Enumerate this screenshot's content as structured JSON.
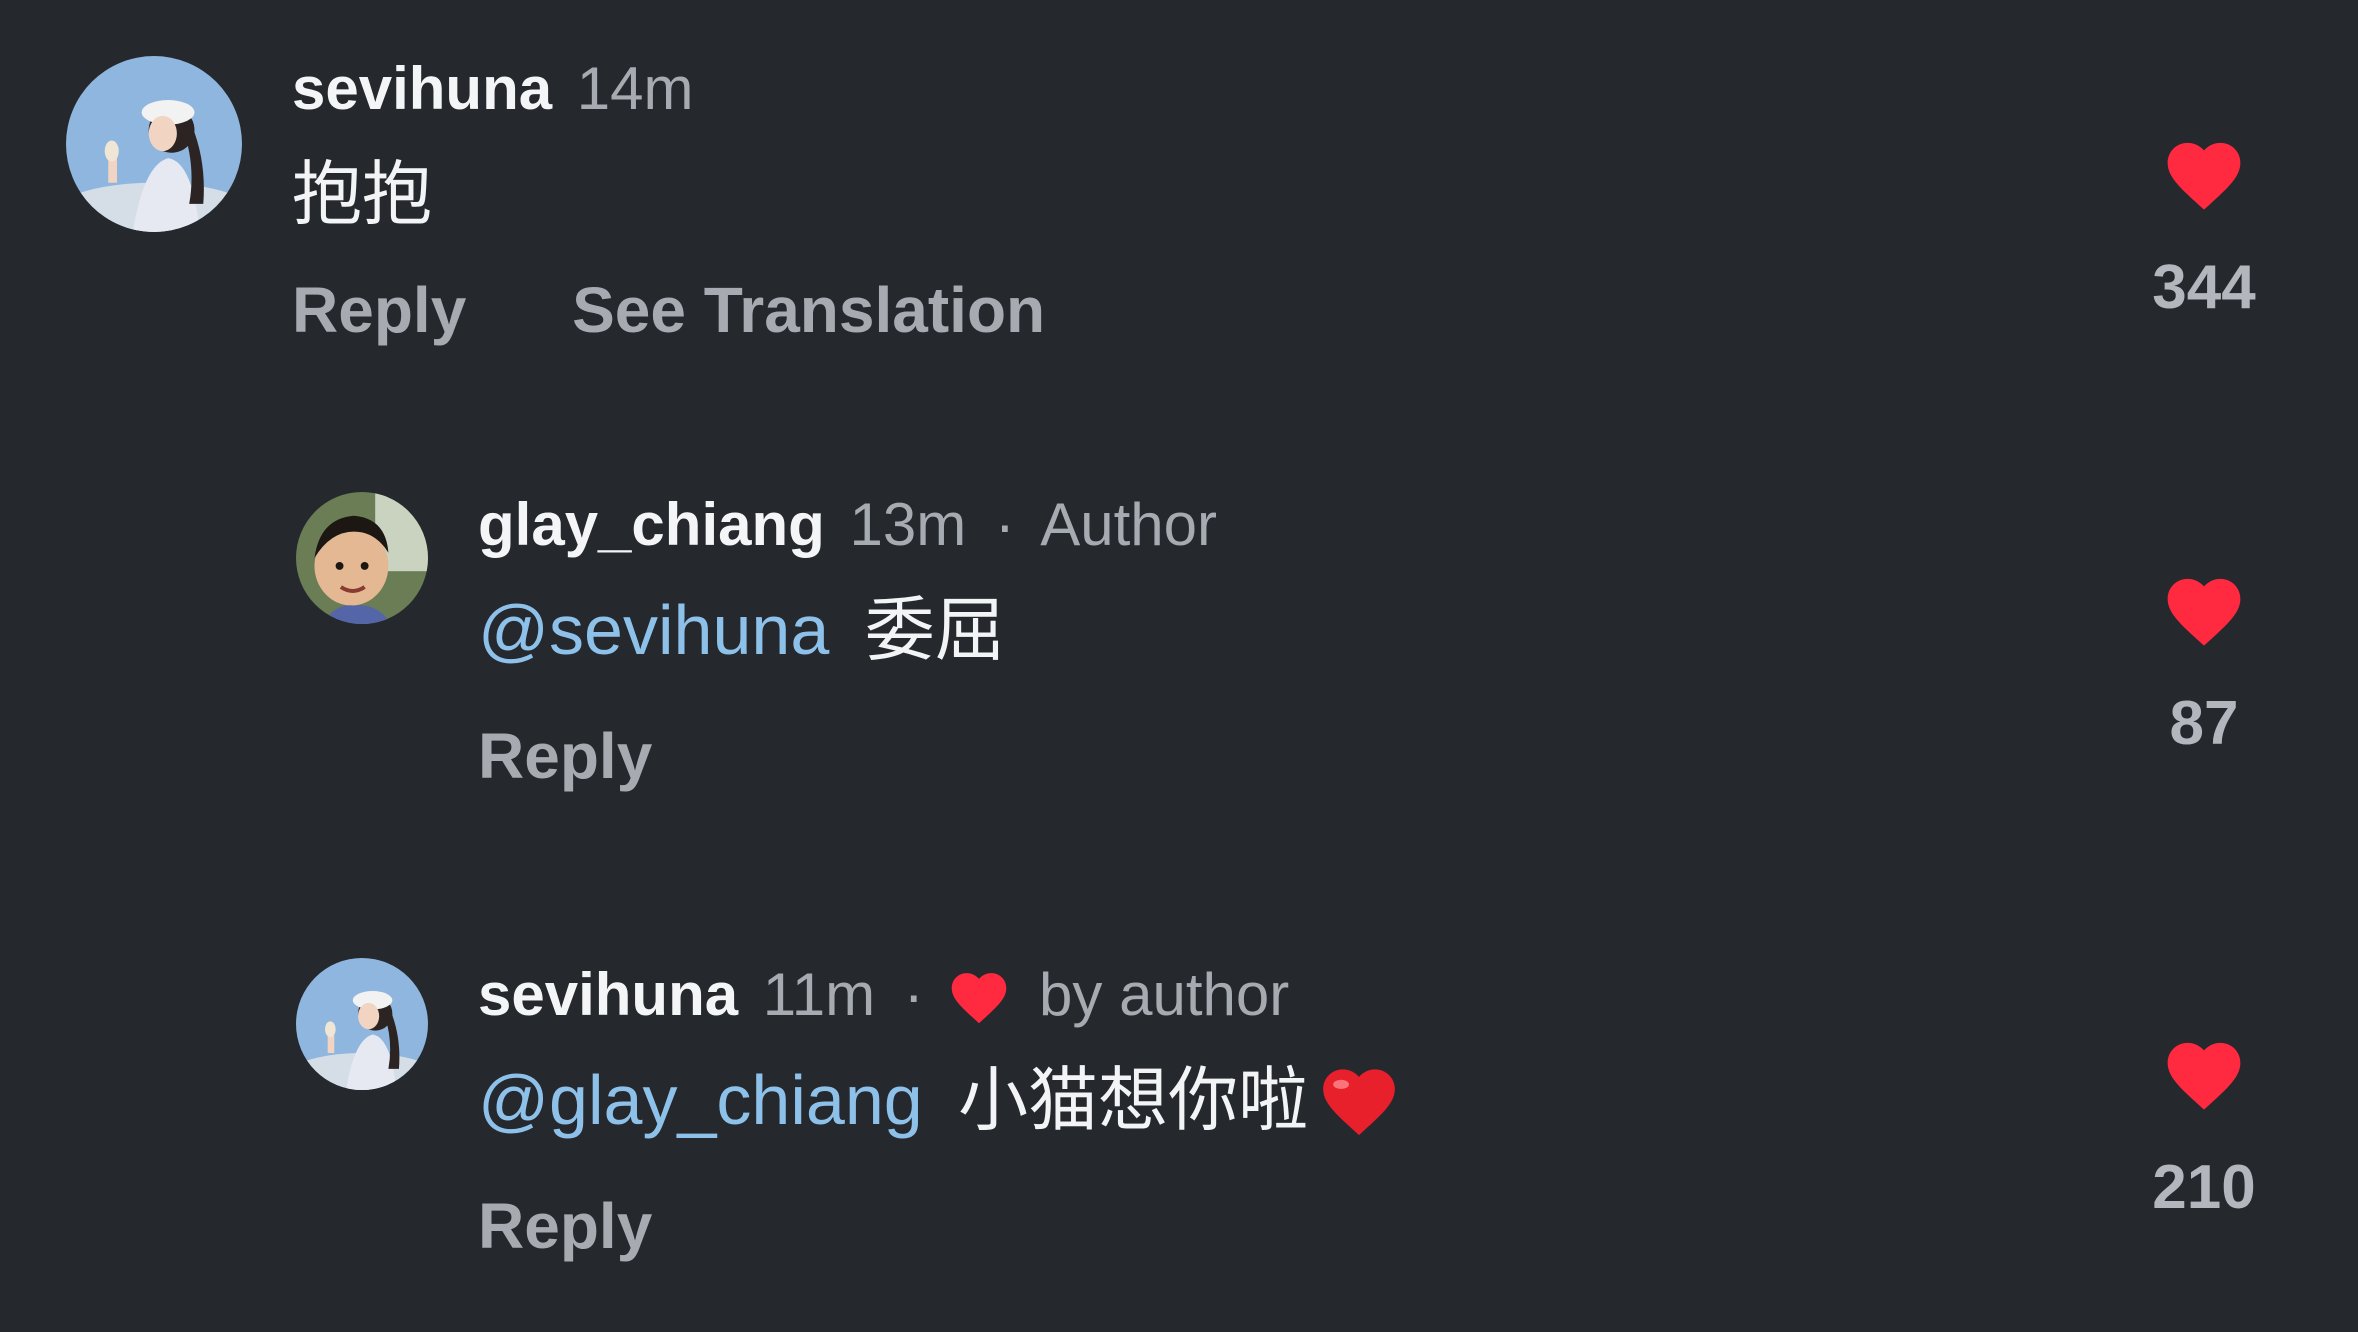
{
  "colors": {
    "background": "#25282d",
    "like_red": "#ff2a40",
    "mention_blue": "#8ec1ea",
    "muted_text": "#a7abb1"
  },
  "comments": [
    {
      "username": "sevihuna",
      "time": "14m",
      "text": "抱抱",
      "actions": {
        "reply": "Reply",
        "translate": "See Translation"
      },
      "likes": "344",
      "like_icon": "heart-icon-filled"
    },
    {
      "username": "glay_chiang",
      "time": "13m",
      "separator": "·",
      "badge": "Author",
      "mention": "@sevihuna",
      "text": "委屈",
      "actions": {
        "reply": "Reply"
      },
      "likes": "87",
      "like_icon": "heart-icon-filled"
    },
    {
      "username": "sevihuna",
      "time": "11m",
      "separator": "·",
      "liked_by": "by author",
      "mention": "@glay_chiang",
      "text": "小猫想你啦",
      "emoji": "red-heart-emoji",
      "actions": {
        "reply": "Reply"
      },
      "likes": "210",
      "like_icon": "heart-icon-filled"
    }
  ]
}
